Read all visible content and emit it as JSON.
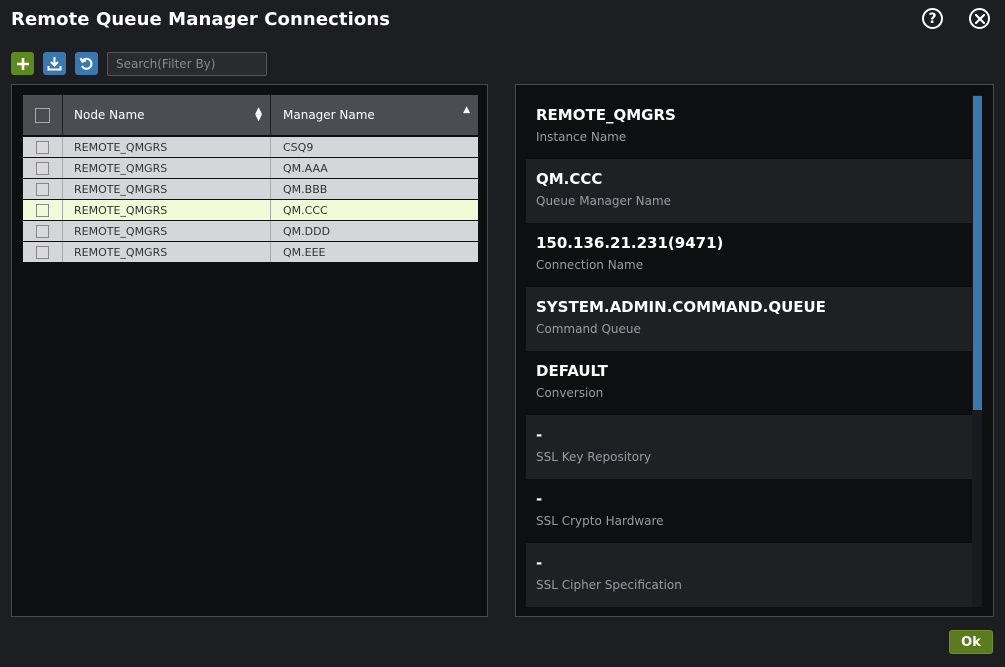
{
  "dialog": {
    "title": "Remote Queue Manager Connections",
    "help_icon": "question-icon",
    "close_icon": "close-icon"
  },
  "toolbar": {
    "add_icon": "plus-icon",
    "download_icon": "download-icon",
    "refresh_icon": "refresh-icon",
    "search_placeholder": "Search(Filter By)",
    "search_value": "",
    "colors": {
      "add": "#5c8a1e",
      "download": "#3a78b0",
      "refresh": "#3a78b0"
    }
  },
  "grid": {
    "columns": [
      "Node Name",
      "Manager Name"
    ],
    "sorted_column": "Manager Name",
    "sort_direction": "ascending",
    "rows": [
      {
        "node": "REMOTE_QMGRS",
        "manager": "CSQ9",
        "selected": false
      },
      {
        "node": "REMOTE_QMGRS",
        "manager": "QM.AAA",
        "selected": false
      },
      {
        "node": "REMOTE_QMGRS",
        "manager": "QM.BBB",
        "selected": false
      },
      {
        "node": "REMOTE_QMGRS",
        "manager": "QM.CCC",
        "selected": true
      },
      {
        "node": "REMOTE_QMGRS",
        "manager": "QM.DDD",
        "selected": false
      },
      {
        "node": "REMOTE_QMGRS",
        "manager": "QM.EEE",
        "selected": false
      }
    ]
  },
  "details": [
    {
      "value": "REMOTE_QMGRS",
      "label": "Instance Name"
    },
    {
      "value": "QM.CCC",
      "label": "Queue Manager Name"
    },
    {
      "value": "150.136.21.231(9471)",
      "label": "Connection Name"
    },
    {
      "value": "SYSTEM.ADMIN.COMMAND.QUEUE",
      "label": "Command Queue"
    },
    {
      "value": "DEFAULT",
      "label": "Conversion"
    },
    {
      "value": "-",
      "label": "SSL Key Repository"
    },
    {
      "value": "-",
      "label": "SSL Crypto Hardware"
    },
    {
      "value": "-",
      "label": "SSL Cipher Specification"
    }
  ],
  "footer": {
    "ok_label": "Ok",
    "ok_color": "#5c7a1e"
  }
}
